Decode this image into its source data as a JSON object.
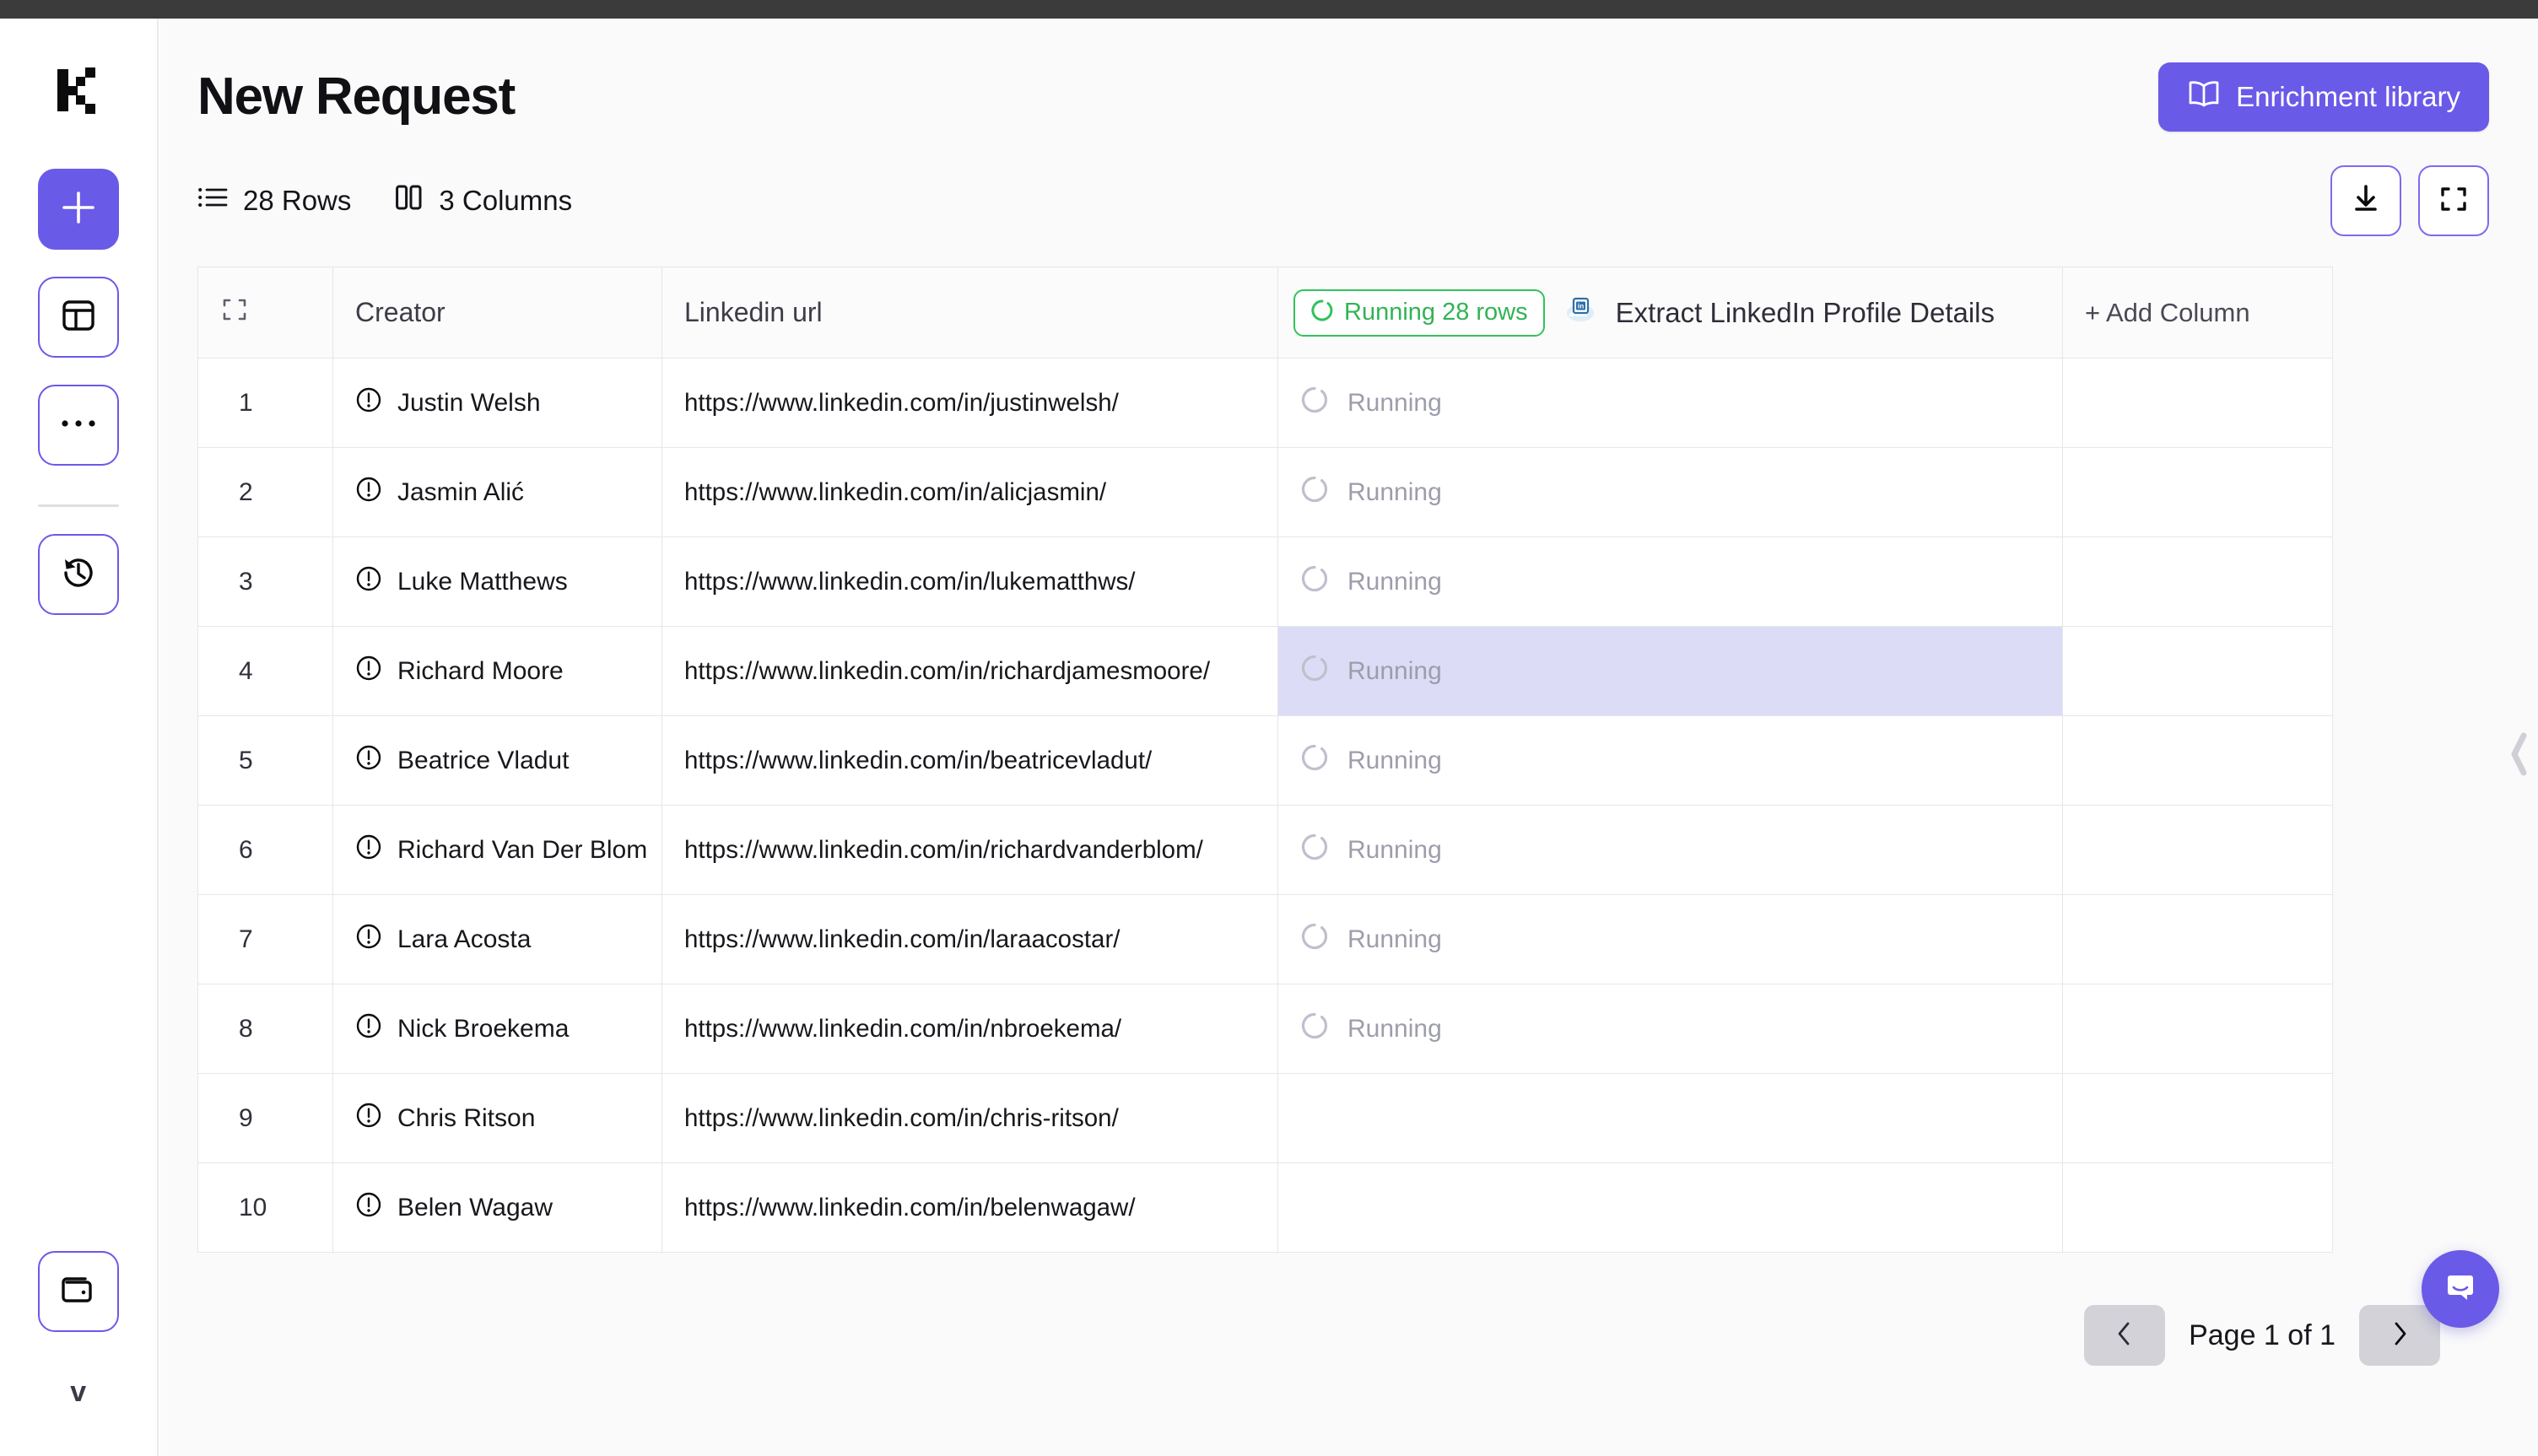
{
  "window": {
    "chrome_bar": ""
  },
  "sidebar": {
    "logo_name": "kleo-logo",
    "items": [
      {
        "name": "new-request-button",
        "icon": "plus-icon",
        "style": "primary"
      },
      {
        "name": "tables-button",
        "icon": "table-icon",
        "style": "ghost"
      },
      {
        "name": "more-options-button",
        "icon": "ellipsis-icon",
        "style": "ghost"
      },
      {
        "name": "history-button",
        "icon": "clock-rewind-icon",
        "style": "ghost"
      }
    ],
    "bottom": [
      {
        "name": "billing-button",
        "icon": "wallet-icon",
        "style": "ghost"
      }
    ],
    "avatar_letter": "v"
  },
  "header": {
    "title": "New Request",
    "enrichment_button": {
      "label": "Enrichment library",
      "icon": "book-open-icon"
    }
  },
  "toolbar": {
    "rows_label": "28 Rows",
    "rows_icon": "list-icon",
    "columns_label": "3 Columns",
    "columns_icon": "columns-icon",
    "download_icon": "download-icon",
    "fullscreen_icon": "expand-icon"
  },
  "table": {
    "select_all_icon": "expand-select-icon",
    "columns": [
      {
        "key": "index",
        "label": ""
      },
      {
        "key": "creator",
        "label": "Creator"
      },
      {
        "key": "url",
        "label": "Linkedin url"
      },
      {
        "key": "enrichment",
        "label": "Extract LinkedIn Profile Details"
      },
      {
        "key": "add",
        "label": "+ Add Column"
      }
    ],
    "enrichment_status_chip": "Running 28 rows",
    "enrichment_icon": "linkedin-cloud-icon",
    "row_status_icon": "alert-circle-icon",
    "selected_row_index": 4,
    "rows": [
      {
        "index": "1",
        "creator": "Justin Welsh",
        "url": "https://www.linkedin.com/in/justinwelsh/",
        "status": "Running"
      },
      {
        "index": "2",
        "creator": "Jasmin Alić",
        "url": "https://www.linkedin.com/in/alicjasmin/",
        "status": "Running"
      },
      {
        "index": "3",
        "creator": "Luke Matthews",
        "url": "https://www.linkedin.com/in/lukematthws/",
        "status": "Running"
      },
      {
        "index": "4",
        "creator": "Richard Moore",
        "url": "https://www.linkedin.com/in/richardjamesmoore/",
        "status": "Running"
      },
      {
        "index": "5",
        "creator": "Beatrice Vladut",
        "url": "https://www.linkedin.com/in/beatricevladut/",
        "status": "Running"
      },
      {
        "index": "6",
        "creator": "Richard Van Der Blom",
        "url": "https://www.linkedin.com/in/richardvanderblom/",
        "status": "Running"
      },
      {
        "index": "7",
        "creator": "Lara Acosta",
        "url": "https://www.linkedin.com/in/laraacostar/",
        "status": "Running"
      },
      {
        "index": "8",
        "creator": "Nick Broekema",
        "url": "https://www.linkedin.com/in/nbroekema/",
        "status": "Running"
      },
      {
        "index": "9",
        "creator": "Chris Ritson",
        "url": "https://www.linkedin.com/in/chris-ritson/",
        "status": ""
      },
      {
        "index": "10",
        "creator": "Belen Wagaw",
        "url": "https://www.linkedin.com/in/belenwagaw/",
        "status": ""
      }
    ]
  },
  "pagination": {
    "prev_icon": "chevron-left-icon",
    "next_icon": "chevron-right-icon",
    "label": "Page 1 of 1"
  },
  "floating": {
    "collapse_panel_icon": "chevron-left-icon",
    "support_chat_icon": "chat-bubble-icon"
  },
  "colors": {
    "accent": "#6a5ae8",
    "accent_border": "#7b6bf0",
    "success": "#32c25b",
    "selected_cell": "#dcdcf7",
    "page_bg": "#fafafb",
    "muted_text": "#9d9dab"
  }
}
